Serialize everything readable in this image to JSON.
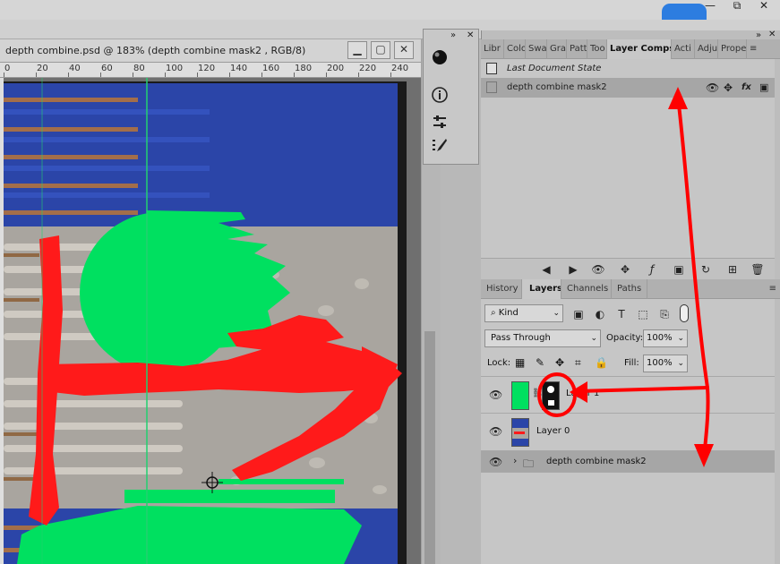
{
  "window": {
    "controls": [
      "—",
      "⧉",
      "✕"
    ]
  },
  "document": {
    "title": "depth combine.psd @ 183% (depth combine mask2 , RGB/8)",
    "minimize": "▁",
    "maximize": "▢",
    "close": "✕",
    "ruler_ticks": [
      "0",
      "20",
      "40",
      "60",
      "80",
      "100",
      "120",
      "140",
      "160",
      "180",
      "200",
      "220",
      "240"
    ]
  },
  "mini_panel": {
    "collapse": "»",
    "close": "✕",
    "icons": [
      "sphere-icon",
      "info-icon",
      "adjust-icon",
      "brush-icon"
    ]
  },
  "comps_panel": {
    "tabs": [
      "Libr",
      "Colo",
      "Swa",
      "Gra",
      "Patt",
      "Too",
      "Layer Comps",
      "Acti",
      "Adju",
      "Prope"
    ],
    "active_tab": "Layer Comps",
    "rows": [
      {
        "label": "Last Document State",
        "italic": true
      },
      {
        "label": "depth combine mask2",
        "italic": false,
        "selected": true
      }
    ]
  },
  "layers_panel": {
    "tabs": [
      "History",
      "Layers",
      "Channels",
      "Paths"
    ],
    "active_tab": "Layers",
    "filter_kind": "Kind",
    "blend_mode": "Pass Through",
    "opacity_label": "Opacity:",
    "opacity_value": "100%",
    "lock_label": "Lock:",
    "fill_label": "Fill:",
    "fill_value": "100%",
    "layers": [
      {
        "name": "Layer 1",
        "type": "layer-with-mask"
      },
      {
        "name": "Layer 0",
        "type": "layer"
      },
      {
        "name": "depth combine mask2",
        "type": "group"
      }
    ]
  },
  "colors": {
    "annotation": "#ff0000",
    "mask_green": "#00e060",
    "canvas_blue": "#2b45a8",
    "selection": "#a6a6a6"
  }
}
